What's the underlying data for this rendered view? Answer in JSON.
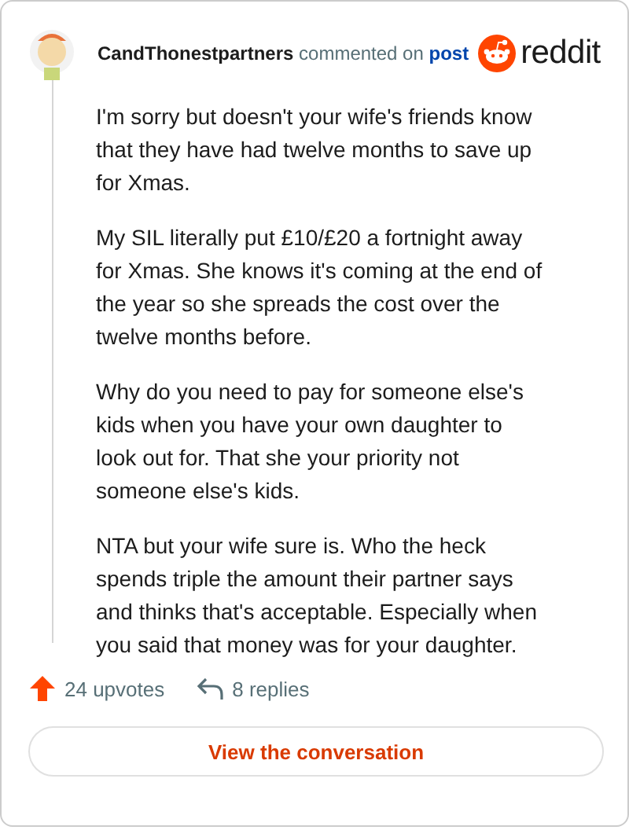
{
  "comment": {
    "author": "CandThonestpartners",
    "action": "commented on",
    "target": "post",
    "brand": "reddit",
    "paragraphs": [
      "I'm sorry but doesn't your wife's friends know that they have had twelve months to save up for Xmas.",
      "My SIL literally put £10/£20 a fortnight away for Xmas. She knows it's coming at the end of the year so she spreads the cost over the twelve months before.",
      "Why do you need to pay for someone else's kids when you have your own daughter to look out for. That she your priority not someone else's kids.",
      "NTA but your wife sure is. Who the heck spends triple the amount their partner says and thinks that's acceptable. Especially when you said that money was for your daughter."
    ],
    "upvotes": "24 upvotes",
    "replies": "8 replies",
    "button": "View the conversation"
  }
}
